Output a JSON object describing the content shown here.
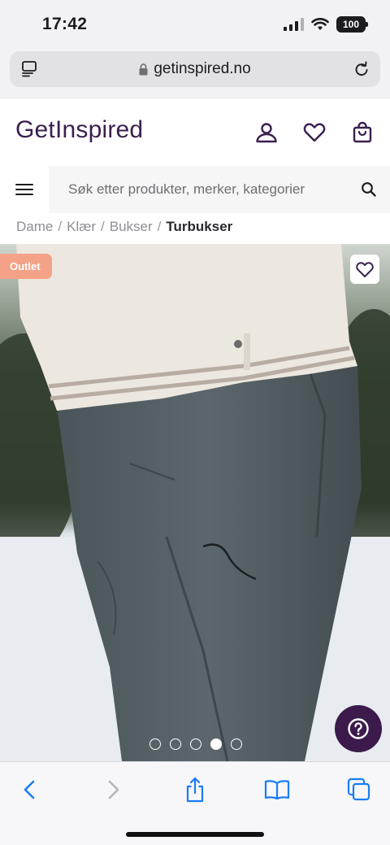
{
  "status_bar": {
    "time": "17:42",
    "battery": "100"
  },
  "browser": {
    "url": "getinspired.no"
  },
  "header": {
    "logo": "GetInspired"
  },
  "search": {
    "placeholder": "Søk etter produkter, merker, kategorier"
  },
  "breadcrumb": {
    "items": [
      "Dame",
      "Klær",
      "Bukser"
    ],
    "separator": "/",
    "current": "Turbukser"
  },
  "product": {
    "badge": "Outlet",
    "image_count": 5,
    "active_image": 4
  },
  "icons": [
    "tabs-icon",
    "lock-icon",
    "reload-icon",
    "account-icon",
    "wishlist-icon",
    "cart-icon",
    "menu-icon",
    "search-icon",
    "heart-icon",
    "help-icon",
    "back-icon",
    "forward-icon",
    "share-icon",
    "bookmarks-icon",
    "tabs-overview-icon"
  ],
  "colors": {
    "brand": "#3b1f4f",
    "badge": "#f4a287",
    "help_button": "#3c1a4c",
    "safari_blue": "#1a7cf5"
  }
}
